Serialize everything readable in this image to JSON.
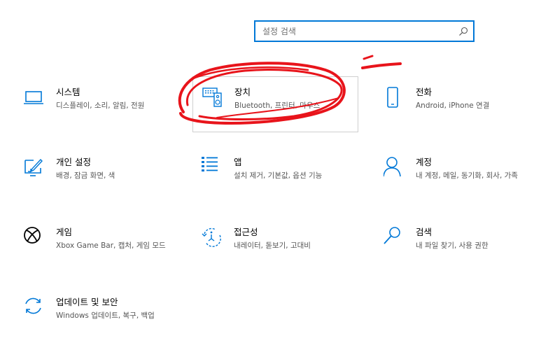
{
  "search": {
    "placeholder": "설정 검색"
  },
  "tiles": {
    "system": {
      "title": "시스템",
      "desc": "디스플레이, 소리, 알림, 전원"
    },
    "devices": {
      "title": "장치",
      "desc": "Bluetooth, 프린터, 마우스"
    },
    "phone": {
      "title": "전화",
      "desc": "Android, iPhone 연결"
    },
    "personal": {
      "title": "개인 설정",
      "desc": "배경, 잠금 화면, 색"
    },
    "apps": {
      "title": "앱",
      "desc": "설치 제거, 기본값, 옵션 기능"
    },
    "accounts": {
      "title": "계정",
      "desc": "내 계정, 메일, 동기화, 회사, 가족"
    },
    "gaming": {
      "title": "게임",
      "desc": "Xbox Game Bar, 캡처, 게임 모드"
    },
    "access": {
      "title": "접근성",
      "desc": "내레이터, 돋보기, 고대비"
    },
    "search": {
      "title": "검색",
      "desc": "내 파일 찾기, 사용 권한"
    },
    "update": {
      "title": "업데이트 및 보안",
      "desc": "Windows 업데이트, 복구, 백업"
    }
  },
  "colors": {
    "accent": "#0078d7",
    "annotation": "#e8141b"
  },
  "icons": {
    "system": "laptop-icon",
    "devices": "keyboard-speaker-icon",
    "phone": "phone-icon",
    "personal": "paint-brush-icon",
    "apps": "apps-list-icon",
    "accounts": "person-icon",
    "gaming": "xbox-icon",
    "access": "ease-of-access-icon",
    "search": "search-icon",
    "update": "sync-icon"
  }
}
